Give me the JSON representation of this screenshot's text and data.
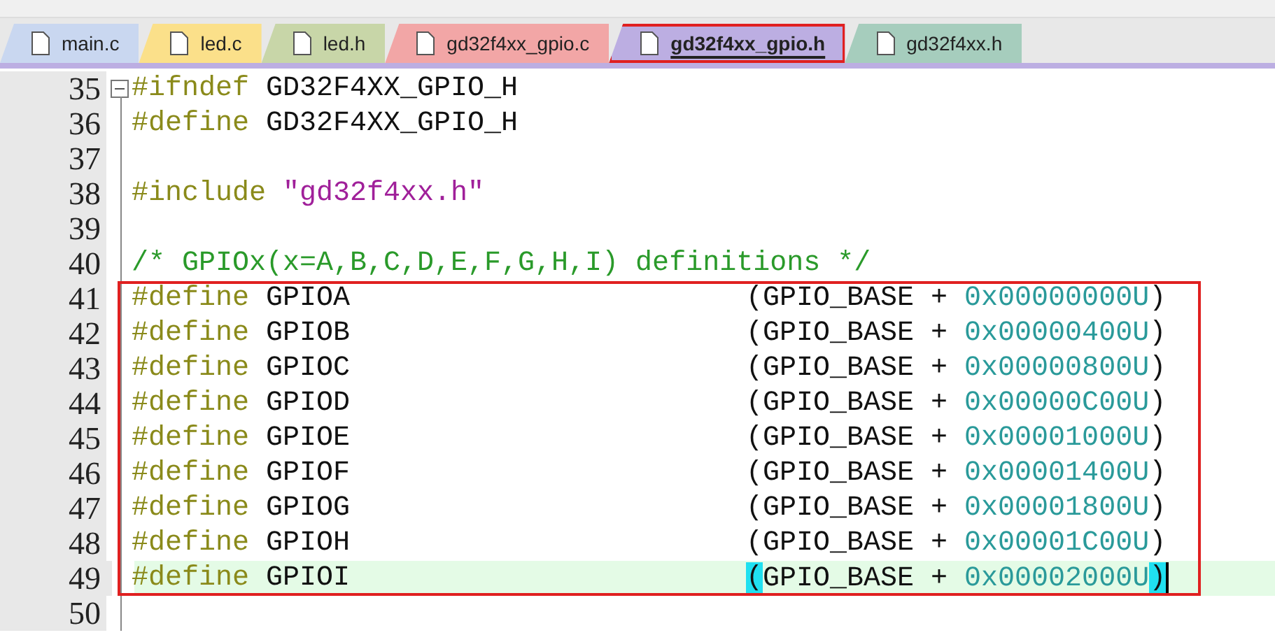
{
  "tabs": [
    {
      "label": "main.c",
      "selected": false,
      "color": "#c9d7f0",
      "annotated": false
    },
    {
      "label": "led.c",
      "selected": false,
      "color": "#fbe08a",
      "annotated": false
    },
    {
      "label": "led.h",
      "selected": false,
      "color": "#c8d6a8",
      "annotated": false
    },
    {
      "label": "gd32f4xx_gpio.c",
      "selected": false,
      "color": "#f2a6a6",
      "annotated": false
    },
    {
      "label": "gd32f4xx_gpio.h",
      "selected": true,
      "color": "#bcaee2",
      "annotated": true
    },
    {
      "label": "gd32f4xx.h",
      "selected": false,
      "color": "#a6cdbd",
      "annotated": false
    }
  ],
  "editor": {
    "lines": [
      {
        "number": "35",
        "fold": true,
        "current": false,
        "boxed": false,
        "code": [
          {
            "text": "#ifndef",
            "kind": "directive"
          },
          {
            "text": " GD32F4XX_GPIO_H",
            "kind": "plain"
          }
        ]
      },
      {
        "number": "36",
        "fold": false,
        "current": false,
        "boxed": false,
        "code": [
          {
            "text": "#define",
            "kind": "directive"
          },
          {
            "text": " GD32F4XX_GPIO_H",
            "kind": "plain"
          }
        ]
      },
      {
        "number": "37",
        "fold": false,
        "current": false,
        "boxed": false
      },
      {
        "number": "38",
        "fold": false,
        "current": false,
        "boxed": false,
        "code": [
          {
            "text": "#include",
            "kind": "directive"
          },
          {
            "text": " \"gd32f4xx.h\"",
            "kind": "string"
          }
        ]
      },
      {
        "number": "39",
        "fold": false,
        "current": false,
        "boxed": false
      },
      {
        "number": "40",
        "fold": false,
        "current": false,
        "boxed": false,
        "code": [
          {
            "text": "/* GPIOx(x=A,B,C,D,E,F,G,H,I) definitions */",
            "kind": "comment"
          }
        ]
      },
      {
        "number": "41",
        "fold": false,
        "current": false,
        "boxed": true,
        "code": [
          {
            "text": "#define",
            "kind": "directive"
          },
          {
            "text": " GPIOA",
            "kind": "plain"
          }
        ],
        "value": [
          {
            "text": "(",
            "kind": "paren",
            "matched": false
          },
          {
            "text": "GPIO_BASE + ",
            "kind": "plain"
          },
          {
            "text": "0x00000000U",
            "kind": "number"
          },
          {
            "text": ")",
            "kind": "paren",
            "matched": false
          }
        ]
      },
      {
        "number": "42",
        "fold": false,
        "current": false,
        "boxed": true,
        "code": [
          {
            "text": "#define",
            "kind": "directive"
          },
          {
            "text": " GPIOB",
            "kind": "plain"
          }
        ],
        "value": [
          {
            "text": "(",
            "kind": "paren",
            "matched": false
          },
          {
            "text": "GPIO_BASE + ",
            "kind": "plain"
          },
          {
            "text": "0x00000400U",
            "kind": "number"
          },
          {
            "text": ")",
            "kind": "paren",
            "matched": false
          }
        ]
      },
      {
        "number": "43",
        "fold": false,
        "current": false,
        "boxed": true,
        "code": [
          {
            "text": "#define",
            "kind": "directive"
          },
          {
            "text": " GPIOC",
            "kind": "plain"
          }
        ],
        "value": [
          {
            "text": "(",
            "kind": "paren",
            "matched": false
          },
          {
            "text": "GPIO_BASE + ",
            "kind": "plain"
          },
          {
            "text": "0x00000800U",
            "kind": "number"
          },
          {
            "text": ")",
            "kind": "paren",
            "matched": false
          }
        ]
      },
      {
        "number": "44",
        "fold": false,
        "current": false,
        "boxed": true,
        "code": [
          {
            "text": "#define",
            "kind": "directive"
          },
          {
            "text": " GPIOD",
            "kind": "plain"
          }
        ],
        "value": [
          {
            "text": "(",
            "kind": "paren",
            "matched": false
          },
          {
            "text": "GPIO_BASE + ",
            "kind": "plain"
          },
          {
            "text": "0x00000C00U",
            "kind": "number"
          },
          {
            "text": ")",
            "kind": "paren",
            "matched": false
          }
        ]
      },
      {
        "number": "45",
        "fold": false,
        "current": false,
        "boxed": true,
        "code": [
          {
            "text": "#define",
            "kind": "directive"
          },
          {
            "text": " GPIOE",
            "kind": "plain"
          }
        ],
        "value": [
          {
            "text": "(",
            "kind": "paren",
            "matched": false
          },
          {
            "text": "GPIO_BASE + ",
            "kind": "plain"
          },
          {
            "text": "0x00001000U",
            "kind": "number"
          },
          {
            "text": ")",
            "kind": "paren",
            "matched": false
          }
        ]
      },
      {
        "number": "46",
        "fold": false,
        "current": false,
        "boxed": true,
        "code": [
          {
            "text": "#define",
            "kind": "directive"
          },
          {
            "text": " GPIOF",
            "kind": "plain"
          }
        ],
        "value": [
          {
            "text": "(",
            "kind": "paren",
            "matched": false
          },
          {
            "text": "GPIO_BASE + ",
            "kind": "plain"
          },
          {
            "text": "0x00001400U",
            "kind": "number"
          },
          {
            "text": ")",
            "kind": "paren",
            "matched": false
          }
        ]
      },
      {
        "number": "47",
        "fold": false,
        "current": false,
        "boxed": true,
        "code": [
          {
            "text": "#define",
            "kind": "directive"
          },
          {
            "text": " GPIOG",
            "kind": "plain"
          }
        ],
        "value": [
          {
            "text": "(",
            "kind": "paren",
            "matched": false
          },
          {
            "text": "GPIO_BASE + ",
            "kind": "plain"
          },
          {
            "text": "0x00001800U",
            "kind": "number"
          },
          {
            "text": ")",
            "kind": "paren",
            "matched": false
          }
        ]
      },
      {
        "number": "48",
        "fold": false,
        "current": false,
        "boxed": true,
        "code": [
          {
            "text": "#define",
            "kind": "directive"
          },
          {
            "text": " GPIOH",
            "kind": "plain"
          }
        ],
        "value": [
          {
            "text": "(",
            "kind": "paren",
            "matched": false
          },
          {
            "text": "GPIO_BASE + ",
            "kind": "plain"
          },
          {
            "text": "0x00001C00U",
            "kind": "number"
          },
          {
            "text": ")",
            "kind": "paren",
            "matched": false
          }
        ]
      },
      {
        "number": "49",
        "fold": false,
        "current": true,
        "boxed": true,
        "code": [
          {
            "text": "#define",
            "kind": "directive"
          },
          {
            "text": " GPIOI",
            "kind": "plain"
          }
        ],
        "value": [
          {
            "text": "(",
            "kind": "paren",
            "matched": true
          },
          {
            "text": "GPIO_BASE + ",
            "kind": "plain"
          },
          {
            "text": "0x00002000U",
            "kind": "number"
          },
          {
            "text": ")",
            "kind": "paren",
            "matched": true
          }
        ]
      },
      {
        "number": "50",
        "fold": false,
        "current": false,
        "boxed": false
      }
    ]
  }
}
